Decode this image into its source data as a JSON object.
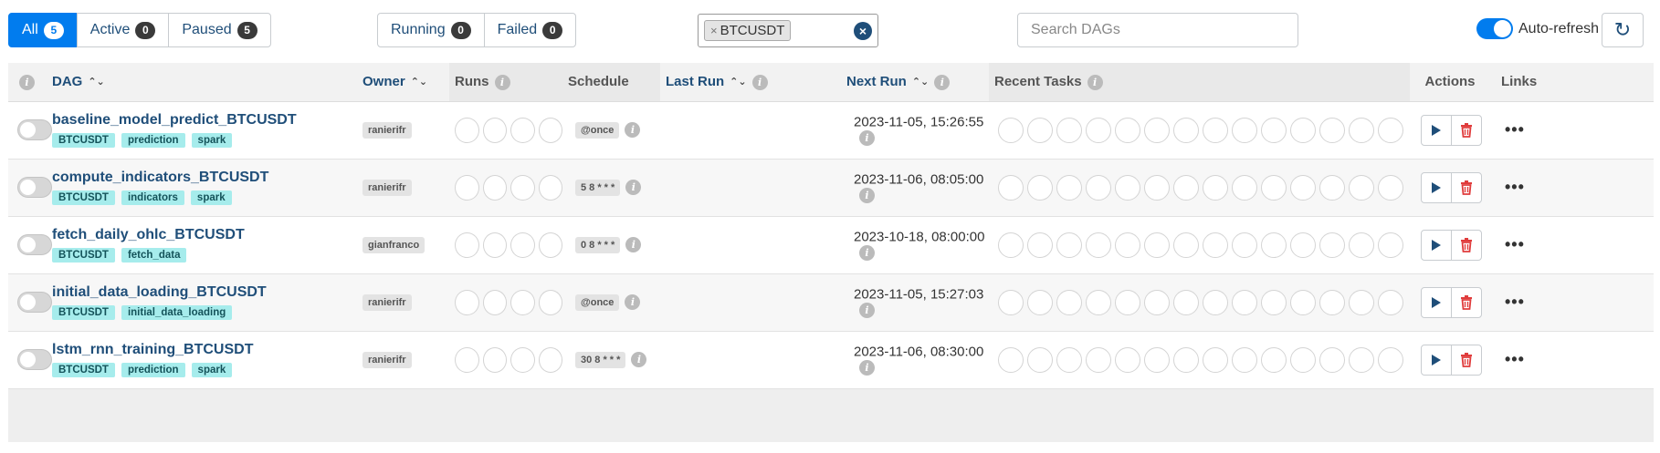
{
  "filters": {
    "status": [
      {
        "label": "All",
        "count": "5",
        "active": true
      },
      {
        "label": "Active",
        "count": "0",
        "active": false
      },
      {
        "label": "Paused",
        "count": "5",
        "active": false
      }
    ],
    "run_state": [
      {
        "label": "Running",
        "count": "0"
      },
      {
        "label": "Failed",
        "count": "0"
      }
    ],
    "tag_chip": "BTCUSDT",
    "tag_chip_remove": "×",
    "tag_clear": "×",
    "search_placeholder": "Search DAGs",
    "autorefresh_label": "Auto-refresh"
  },
  "columns": {
    "dag": "DAG",
    "owner": "Owner",
    "runs": "Runs",
    "schedule": "Schedule",
    "last_run": "Last Run",
    "next_run": "Next Run",
    "recent_tasks": "Recent Tasks",
    "actions": "Actions",
    "links": "Links"
  },
  "icons": {
    "info": "i",
    "sort": "⌃⌄",
    "more": "•••",
    "refresh": "↻"
  },
  "colors": {
    "accent": "#017cee",
    "link": "#1f4e79",
    "tag_bg": "#a6ecec",
    "delete": "#e03c3c"
  },
  "dags": [
    {
      "name": "baseline_model_predict_BTCUSDT",
      "tags": [
        "BTCUSDT",
        "prediction",
        "spark"
      ],
      "owner": "ranierifr",
      "schedule": "@once",
      "last_run": "",
      "next_run": "2023-11-05, 15:26:55",
      "paused": true
    },
    {
      "name": "compute_indicators_BTCUSDT",
      "tags": [
        "BTCUSDT",
        "indicators",
        "spark"
      ],
      "owner": "ranierifr",
      "schedule": "5 8 * * *",
      "last_run": "",
      "next_run": "2023-11-06, 08:05:00",
      "paused": true
    },
    {
      "name": "fetch_daily_ohlc_BTCUSDT",
      "tags": [
        "BTCUSDT",
        "fetch_data"
      ],
      "owner": "gianfranco",
      "schedule": "0 8 * * *",
      "last_run": "",
      "next_run": "2023-10-18, 08:00:00",
      "paused": true
    },
    {
      "name": "initial_data_loading_BTCUSDT",
      "tags": [
        "BTCUSDT",
        "initial_data_loading"
      ],
      "owner": "ranierifr",
      "schedule": "@once",
      "last_run": "",
      "next_run": "2023-11-05, 15:27:03",
      "paused": true
    },
    {
      "name": "lstm_rnn_training_BTCUSDT",
      "tags": [
        "BTCUSDT",
        "prediction",
        "spark"
      ],
      "owner": "ranierifr",
      "schedule": "30 8 * * *",
      "last_run": "",
      "next_run": "2023-11-06, 08:30:00",
      "paused": true
    }
  ]
}
